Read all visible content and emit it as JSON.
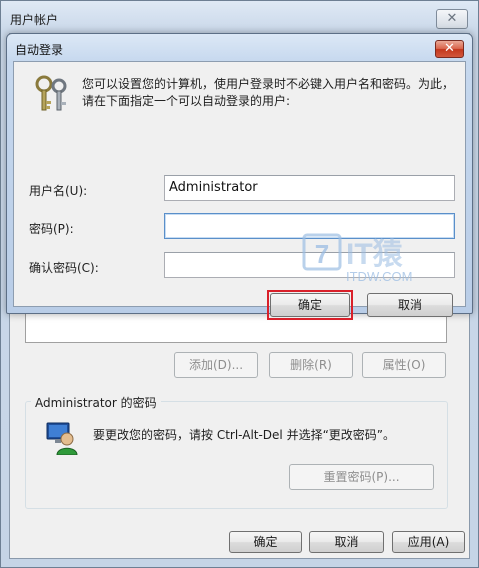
{
  "outer": {
    "title": "用户帐户",
    "close_glyph": "✕",
    "buttons": {
      "add": "添加(D)...",
      "remove": "删除(R)",
      "properties": "属性(O)"
    },
    "password_group": {
      "label": "Administrator 的密码",
      "text": "要更改您的密码，请按 Ctrl-Alt-Del 并选择“更改密码”。",
      "reset_button": "重置密码(P)..."
    },
    "footer": {
      "ok": "确定",
      "cancel": "取消",
      "apply": "应用(A)"
    }
  },
  "dialog": {
    "title": "自动登录",
    "close_glyph": "✕",
    "description": "您可以设置您的计算机，使用户登录时不必键入用户名和密码。为此，请在下面指定一个可以自动登录的用户:",
    "fields": {
      "username_label": "用户名(U):",
      "username_value": "Administrator",
      "password_label": "密码(P):",
      "password_value": "",
      "confirm_label": "确认密码(C):",
      "confirm_value": ""
    },
    "ok": "确定",
    "cancel": "取消"
  },
  "watermark": {
    "brand": "IT猿",
    "domain": "ITDW.COM"
  },
  "icons": {
    "dialog_icon": "keys-icon",
    "group_icon": "user-icon"
  },
  "colors": {
    "highlight": "#d9202a",
    "dialog_close": "#c3361c"
  }
}
